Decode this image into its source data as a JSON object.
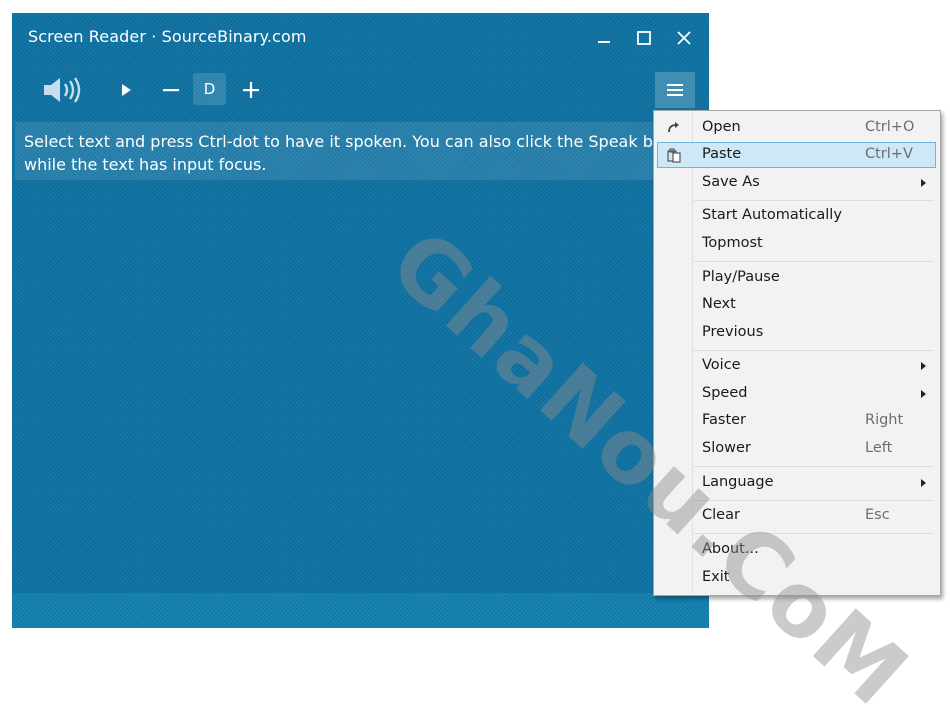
{
  "window": {
    "title": "Screen Reader · SourceBinary.com"
  },
  "toolbar": {
    "voice_letter": "D"
  },
  "content": {
    "text": "Select text and press Ctrl-dot to have it spoken. You can also click the Speak button\nwhile the text has input focus."
  },
  "menu": {
    "items": [
      {
        "label": "Open",
        "shortcut": "Ctrl+O",
        "icon": "redo-arrow-icon"
      },
      {
        "label": "Paste",
        "shortcut": "Ctrl+V",
        "icon": "clipboard-icon",
        "highlighted": true
      },
      {
        "label": "Save As",
        "submenu": true
      },
      {
        "label": "Start Automatically"
      },
      {
        "label": "Topmost"
      },
      {
        "label": "Play/Pause"
      },
      {
        "label": "Next"
      },
      {
        "label": "Previous"
      },
      {
        "label": "Voice",
        "submenu": true
      },
      {
        "label": "Speed",
        "submenu": true
      },
      {
        "label": "Faster",
        "shortcut": "Right"
      },
      {
        "label": "Slower",
        "shortcut": "Left"
      },
      {
        "label": "Language",
        "submenu": true
      },
      {
        "label": "Clear",
        "shortcut": "Esc"
      },
      {
        "label": "About..."
      },
      {
        "label": "Exit"
      }
    ]
  },
  "watermark": {
    "text": "GhaNou.CoM"
  },
  "colors": {
    "window_bg": "#0b6e9e",
    "menu_bg": "#f2f2f2",
    "menu_highlight": "#cde8f6"
  }
}
